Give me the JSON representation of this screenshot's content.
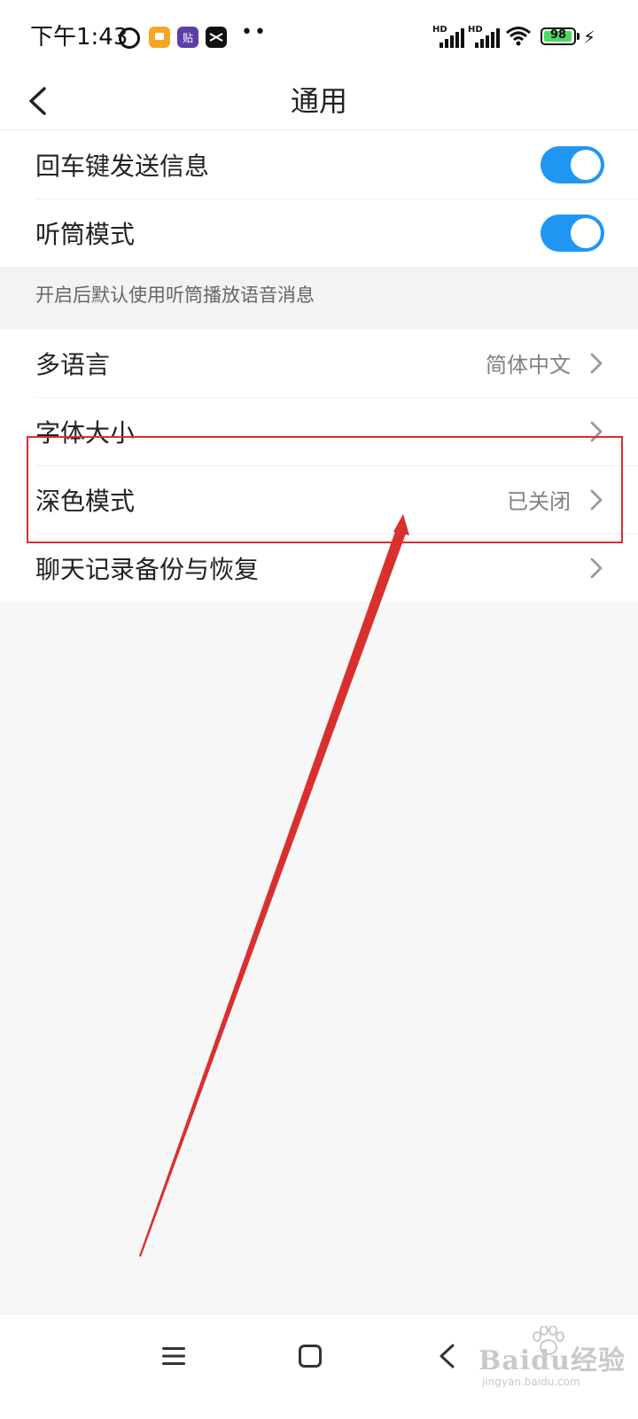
{
  "status_bar": {
    "time": "下午1:43",
    "app_icons": [
      "alarm-icon",
      "orange-app-icon",
      "tieba-app-icon",
      "capcut-app-icon"
    ],
    "purple_app_glyph": "贴",
    "more_dots": "••",
    "signal_label": "HD",
    "battery": {
      "level": 98,
      "level_text": "98",
      "charging": true
    }
  },
  "header": {
    "title": "通用"
  },
  "settings": {
    "group1": [
      {
        "label": "回车键发送信息",
        "type": "toggle",
        "on": true
      },
      {
        "label": "听筒模式",
        "type": "toggle",
        "on": true
      }
    ],
    "hint": "开启后默认使用听筒播放语音消息",
    "group2": [
      {
        "label": "多语言",
        "value": "简体中文"
      },
      {
        "label": "字体大小",
        "value": ""
      },
      {
        "label": "深色模式",
        "value": "已关闭"
      },
      {
        "label": "聊天记录备份与恢复",
        "value": ""
      }
    ]
  },
  "colors": {
    "toggle_on": "#2096f3",
    "annotation": "#d9302e",
    "chevron": "#9a9a9a"
  },
  "watermark": {
    "main": "Baidu经验",
    "sub": "jingyan.baidu.com"
  }
}
